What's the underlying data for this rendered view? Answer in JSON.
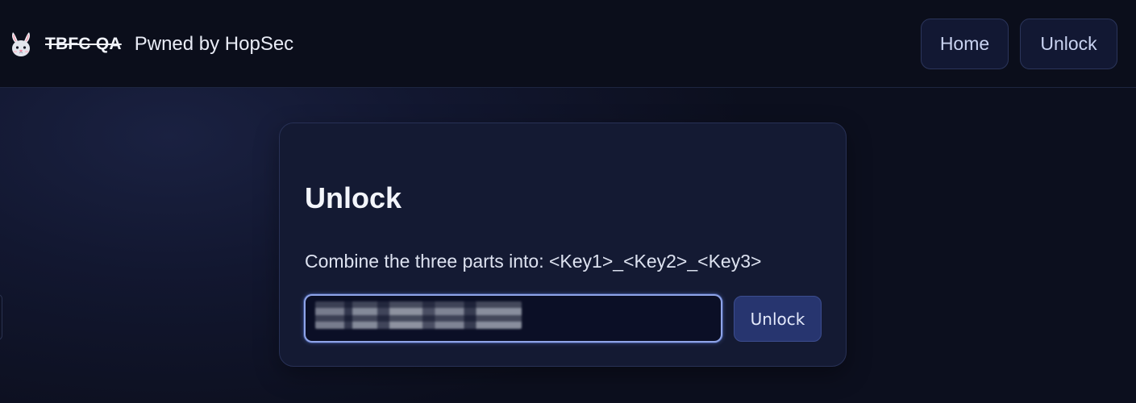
{
  "header": {
    "logo_icon": "bunny-icon",
    "brand_old": "TBFC QA",
    "brand_new": "Pwned by HopSec",
    "nav": [
      {
        "label": "Home"
      },
      {
        "label": "Unlock"
      }
    ]
  },
  "unlock_card": {
    "title": "Unlock",
    "description": "Combine the three parts into: <Key1>_<Key2>_<Key3>",
    "input_value": "",
    "button_label": "Unlock"
  },
  "colors": {
    "background": "#0d1020",
    "card": "#141a33",
    "accent": "#27356f",
    "focus_ring": "#8fa4e8"
  }
}
